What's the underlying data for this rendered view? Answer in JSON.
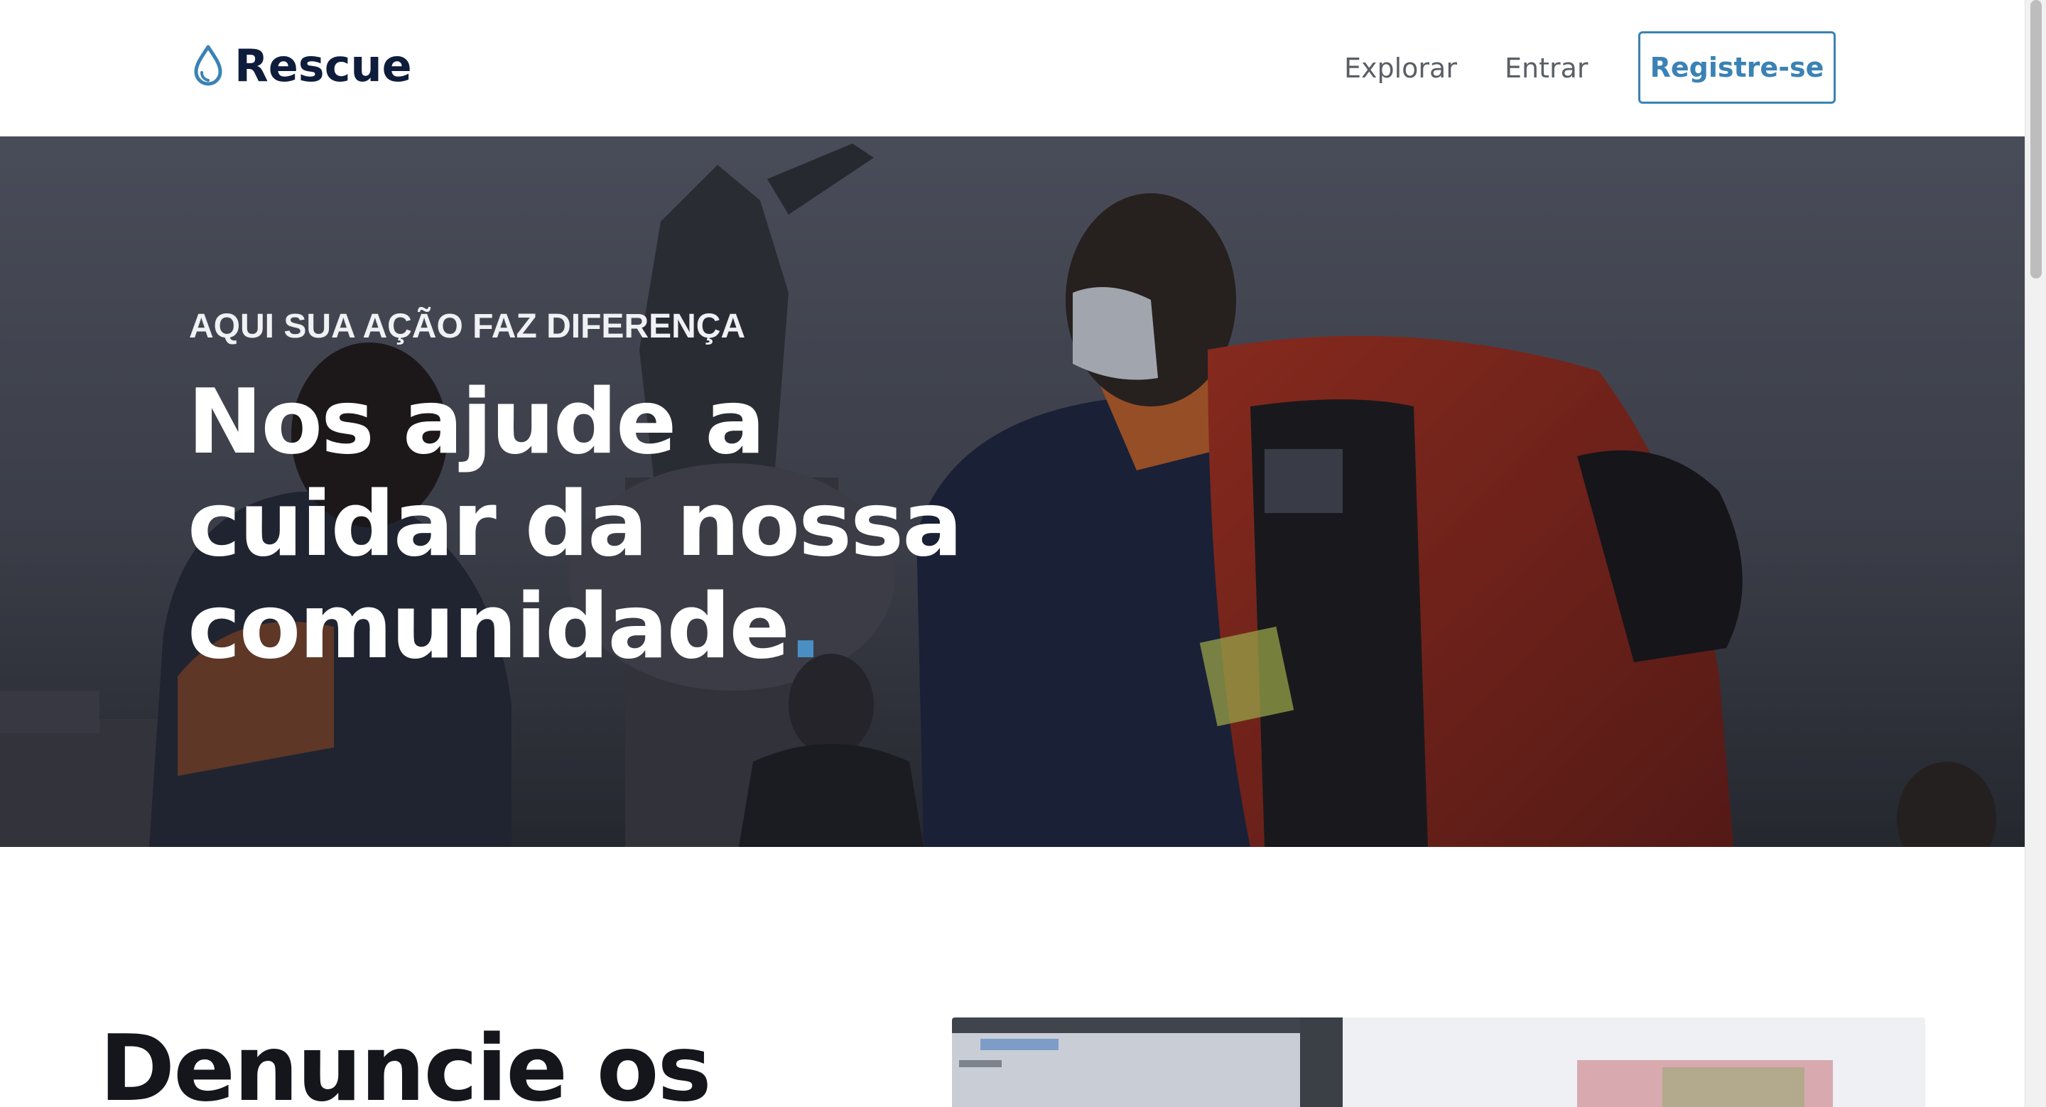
{
  "header": {
    "brand": "Rescue",
    "nav": {
      "explore": "Explorar",
      "login": "Entrar",
      "register": "Registre-se"
    }
  },
  "hero": {
    "eyebrow": "AQUI SUA AÇÃO FAZ DIFERENÇA",
    "title_line1": "Nos ajude a",
    "title_line2": "cuidar da nossa",
    "title_line3": "comunidade",
    "title_dot": ".",
    "background_icon": "emergency-responders-photo"
  },
  "section": {
    "heading": "Denuncie os",
    "image_icon": "laptop-screen-photo"
  },
  "colors": {
    "brand_navy": "#0f1d3c",
    "accent_blue": "#3a82b5",
    "dot_blue": "#4a8fc4",
    "nav_text": "#5a5f66"
  }
}
